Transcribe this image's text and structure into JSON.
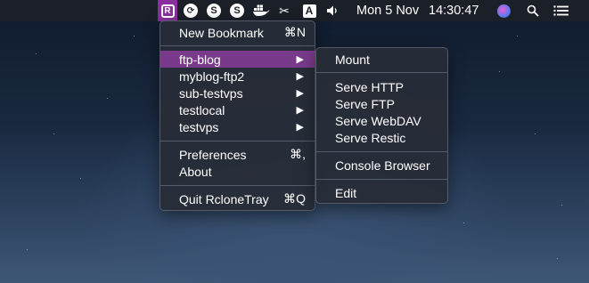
{
  "menubar": {
    "date": "Mon 5 Nov",
    "time": "14:30:47",
    "icons": [
      "rclonetray-icon",
      "sync-icon",
      "skype-icon",
      "skype-icon",
      "docker-icon",
      "scissors-icon",
      "font-icon",
      "volume-icon",
      "siri-icon",
      "spotlight-search-icon",
      "control-center-icon"
    ],
    "rclone_glyph": "R",
    "font_glyph": "A"
  },
  "main_menu": {
    "items": [
      {
        "label": "New Bookmark",
        "shortcut": "⌘N"
      },
      {
        "label": "ftp-blog",
        "arrow": "▶",
        "highlighted": true
      },
      {
        "label": "myblog-ftp2",
        "arrow": "▶"
      },
      {
        "label": "sub-testvps",
        "arrow": "▶"
      },
      {
        "label": "testlocal",
        "arrow": "▶"
      },
      {
        "label": "testvps",
        "arrow": "▶"
      },
      {
        "label": "Preferences",
        "shortcut": "⌘,"
      },
      {
        "label": "About"
      },
      {
        "label": "Quit RcloneTray",
        "shortcut": "⌘Q"
      }
    ]
  },
  "submenu": {
    "items": [
      {
        "label": "Mount"
      },
      {
        "label": "Serve HTTP"
      },
      {
        "label": "Serve FTP"
      },
      {
        "label": "Serve WebDAV"
      },
      {
        "label": "Serve Restic"
      },
      {
        "label": "Console Browser"
      },
      {
        "label": "Edit"
      }
    ]
  },
  "colors": {
    "highlight": "#7a3a8c",
    "menubar": "#1c2028",
    "active_icon": "#8b2fa0"
  }
}
